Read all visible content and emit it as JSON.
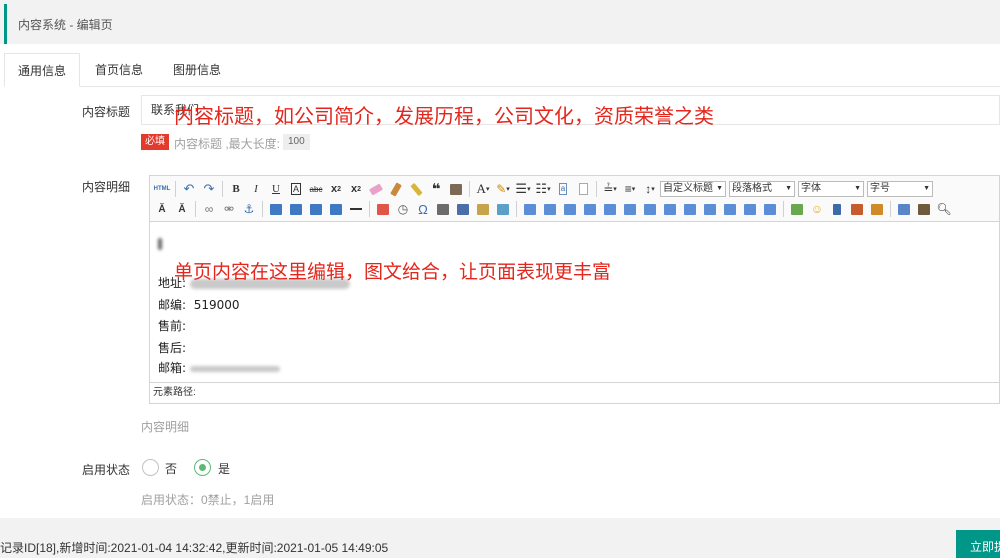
{
  "header": {
    "title": "内容系统 - 编辑页"
  },
  "tabs": [
    {
      "label": "通用信息",
      "active": true
    },
    {
      "label": "首页信息",
      "active": false
    },
    {
      "label": "图册信息",
      "active": false
    }
  ],
  "form": {
    "title": {
      "label": "内容标题",
      "value": "联系我们",
      "overlay_note": "内容标题，如公司简介，发展历程，公司文化，资质荣誉之类",
      "required_badge": "必填",
      "help": "内容标题 ,最大长度:",
      "max_length": "100"
    },
    "body": {
      "label": "内容明细",
      "overlay_note": "单页内容在这里编辑，图文给合，让页面表现更丰富",
      "lines": [
        {
          "label": "地址:",
          "value": ""
        },
        {
          "label": "邮编:",
          "value": "519000"
        },
        {
          "label": "售前:",
          "value": ""
        },
        {
          "label": "售后:",
          "value": ""
        },
        {
          "label": "邮箱:",
          "value": ""
        }
      ],
      "element_path": "元素路径:",
      "help": "内容明细"
    },
    "status": {
      "label": "启用状态",
      "options": [
        {
          "label": "否",
          "checked": false
        },
        {
          "label": "是",
          "checked": true
        }
      ],
      "help": "启用状态：0禁止，1启用"
    }
  },
  "editor_toolbar": {
    "html_button": "HTML",
    "custom_heading": "自定义标题",
    "paragraph_format": "段落格式",
    "font_family": "字体",
    "font_size": "字号"
  },
  "footer": {
    "record_info": "记录ID[18],新增时间:2021-01-04 14:32:42,更新时间:2021-01-05 14:49:05",
    "submit_label": "立即提交"
  },
  "colors": {
    "accent": "#009688",
    "required": "#e43a2c",
    "annotation_red": "#e5261c",
    "radio_checked": "#5fb878"
  }
}
